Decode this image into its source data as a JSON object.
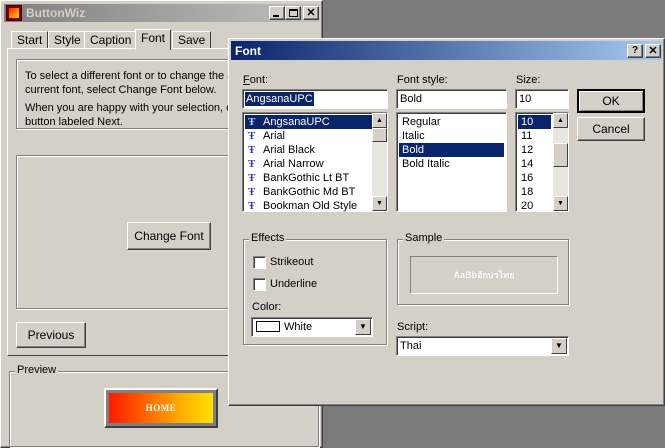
{
  "wizard": {
    "title": "ButtonWiz",
    "tabs": [
      "Start",
      "Style",
      "Caption",
      "Font",
      "Save"
    ],
    "active_tab_index": 3,
    "instructions": [
      "To select a different font or to change the a",
      "current font, select Change Font below.",
      "When you are happy with your selection, cli",
      "button labeled Next."
    ],
    "change_font_label": "Change Font",
    "previous_label": "Previous",
    "preview_label": "Preview",
    "preview_button_text": "HOME"
  },
  "font_dialog": {
    "title": "Font",
    "help_glyph": "?",
    "close_glyph": "×",
    "font_label": "Font:",
    "font_value": "AngsanaUPC",
    "fonts": [
      "AngsanaUPC",
      "Arial",
      "Arial Black",
      "Arial Narrow",
      "BankGothic Lt BT",
      "BankGothic Md BT",
      "Bookman Old Style"
    ],
    "selected_font_index": 0,
    "style_label": "Font style:",
    "style_value": "Bold",
    "styles": [
      "Regular",
      "Italic",
      "Bold",
      "Bold Italic"
    ],
    "selected_style_index": 2,
    "size_label": "Size:",
    "size_value": "10",
    "sizes": [
      "10",
      "11",
      "12",
      "14",
      "16",
      "18",
      "20"
    ],
    "selected_size_index": 0,
    "ok_label": "OK",
    "cancel_label": "Cancel",
    "effects_label": "Effects",
    "strikeout_label": "Strikeout",
    "underline_label": "Underline",
    "strikeout_checked": false,
    "underline_checked": false,
    "color_label": "Color:",
    "color_value": "White",
    "sample_label": "Sample",
    "sample_text": "AaBbอักษรไทย",
    "script_label": "Script:",
    "script_value": "Thai"
  },
  "colors": {
    "dialog_title_start": "#0a246a",
    "dialog_title_end": "#a6caf0",
    "inactive_title_start": "#808080",
    "inactive_title_end": "#c0c0c0",
    "selection": "#0a246a",
    "face": "#d4d0c8"
  }
}
